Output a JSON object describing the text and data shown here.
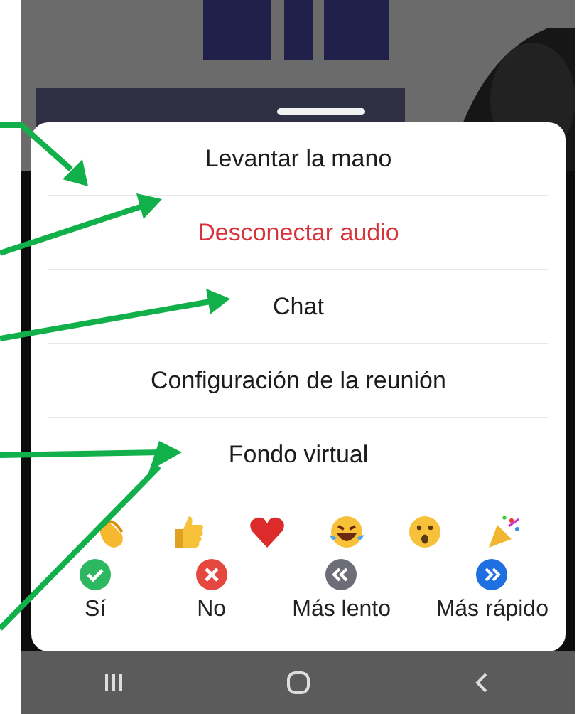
{
  "menu": [
    {
      "label": "Levantar la mano",
      "danger": false
    },
    {
      "label": "Desconectar audio",
      "danger": true
    },
    {
      "label": "Chat",
      "danger": false
    },
    {
      "label": "Configuración de la reunión",
      "danger": false
    },
    {
      "label": "Fondo virtual",
      "danger": false
    }
  ],
  "emoji_reactions": [
    {
      "kind": "clap"
    },
    {
      "kind": "thumbs"
    },
    {
      "kind": "heart"
    },
    {
      "kind": "laugh"
    },
    {
      "kind": "wow"
    },
    {
      "kind": "party"
    }
  ],
  "feedback": [
    {
      "kind": "yes",
      "label": "Sí"
    },
    {
      "kind": "no",
      "label": "No"
    },
    {
      "kind": "slower",
      "label": "Más lento"
    },
    {
      "kind": "faster",
      "label": "Más rápido"
    }
  ]
}
